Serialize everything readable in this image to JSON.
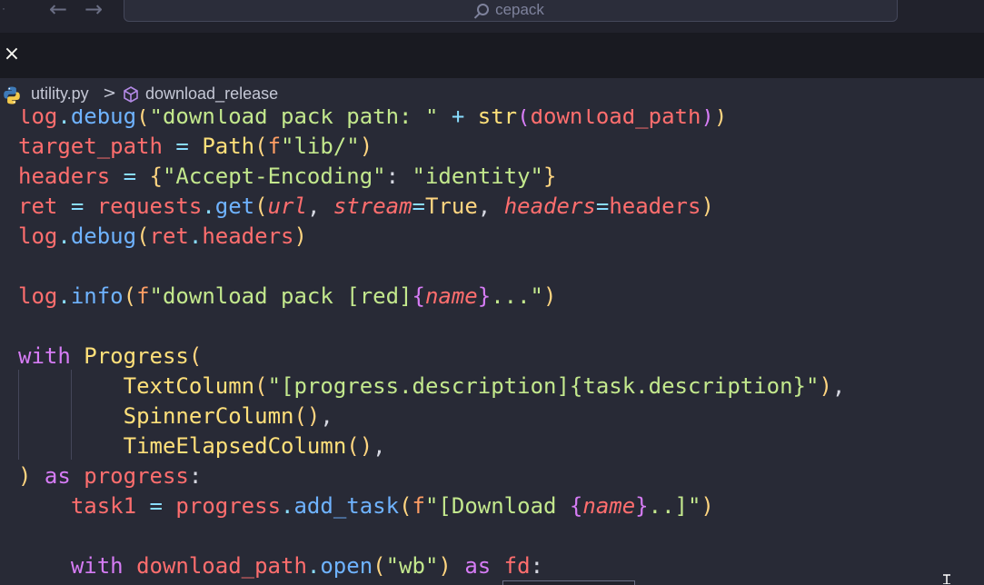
{
  "titlebar": {
    "search_placeholder": "cepack",
    "back_icon": "arrow-left-icon",
    "forward_icon": "arrow-right-icon",
    "search_icon": "search-icon"
  },
  "tab": {
    "close_icon": "close-icon",
    "close_glyph": "×"
  },
  "breadcrumb": {
    "file": "utility.py",
    "separator": ">",
    "symbol": "download_release",
    "file_icon": "python-icon",
    "symbol_icon": "method-icon"
  },
  "code_lines": [
    "log.debug(\"download pack path: \" + str(download_path))",
    "target_path = Path(f\"lib/\")",
    "headers = {\"Accept-Encoding\": \"identity\"}",
    "ret = requests.get(url, stream=True, headers=headers)",
    "log.debug(ret.headers)",
    "",
    "log.info(f\"download pack [red]{name}...\")",
    "",
    "with Progress(",
    "        TextColumn(\"[progress.description]{task.description}\"),",
    "        SpinnerColumn(),",
    "        TimeElapsedColumn(),",
    ") as progress:",
    "    task1 = progress.add_task(f\"[Download {name}..]\")",
    "",
    "    with download_path.open(\"wb\") as fd:"
  ],
  "colors": {
    "editor_bg": "#282a36",
    "titlebar_bg": "#21222c",
    "tabbar_bg": "#191a21",
    "variable": "#ff6e6e",
    "function": "#ffe07a",
    "method": "#6fb3ff",
    "string": "#c3e88d",
    "keyword": "#d67cf5"
  }
}
